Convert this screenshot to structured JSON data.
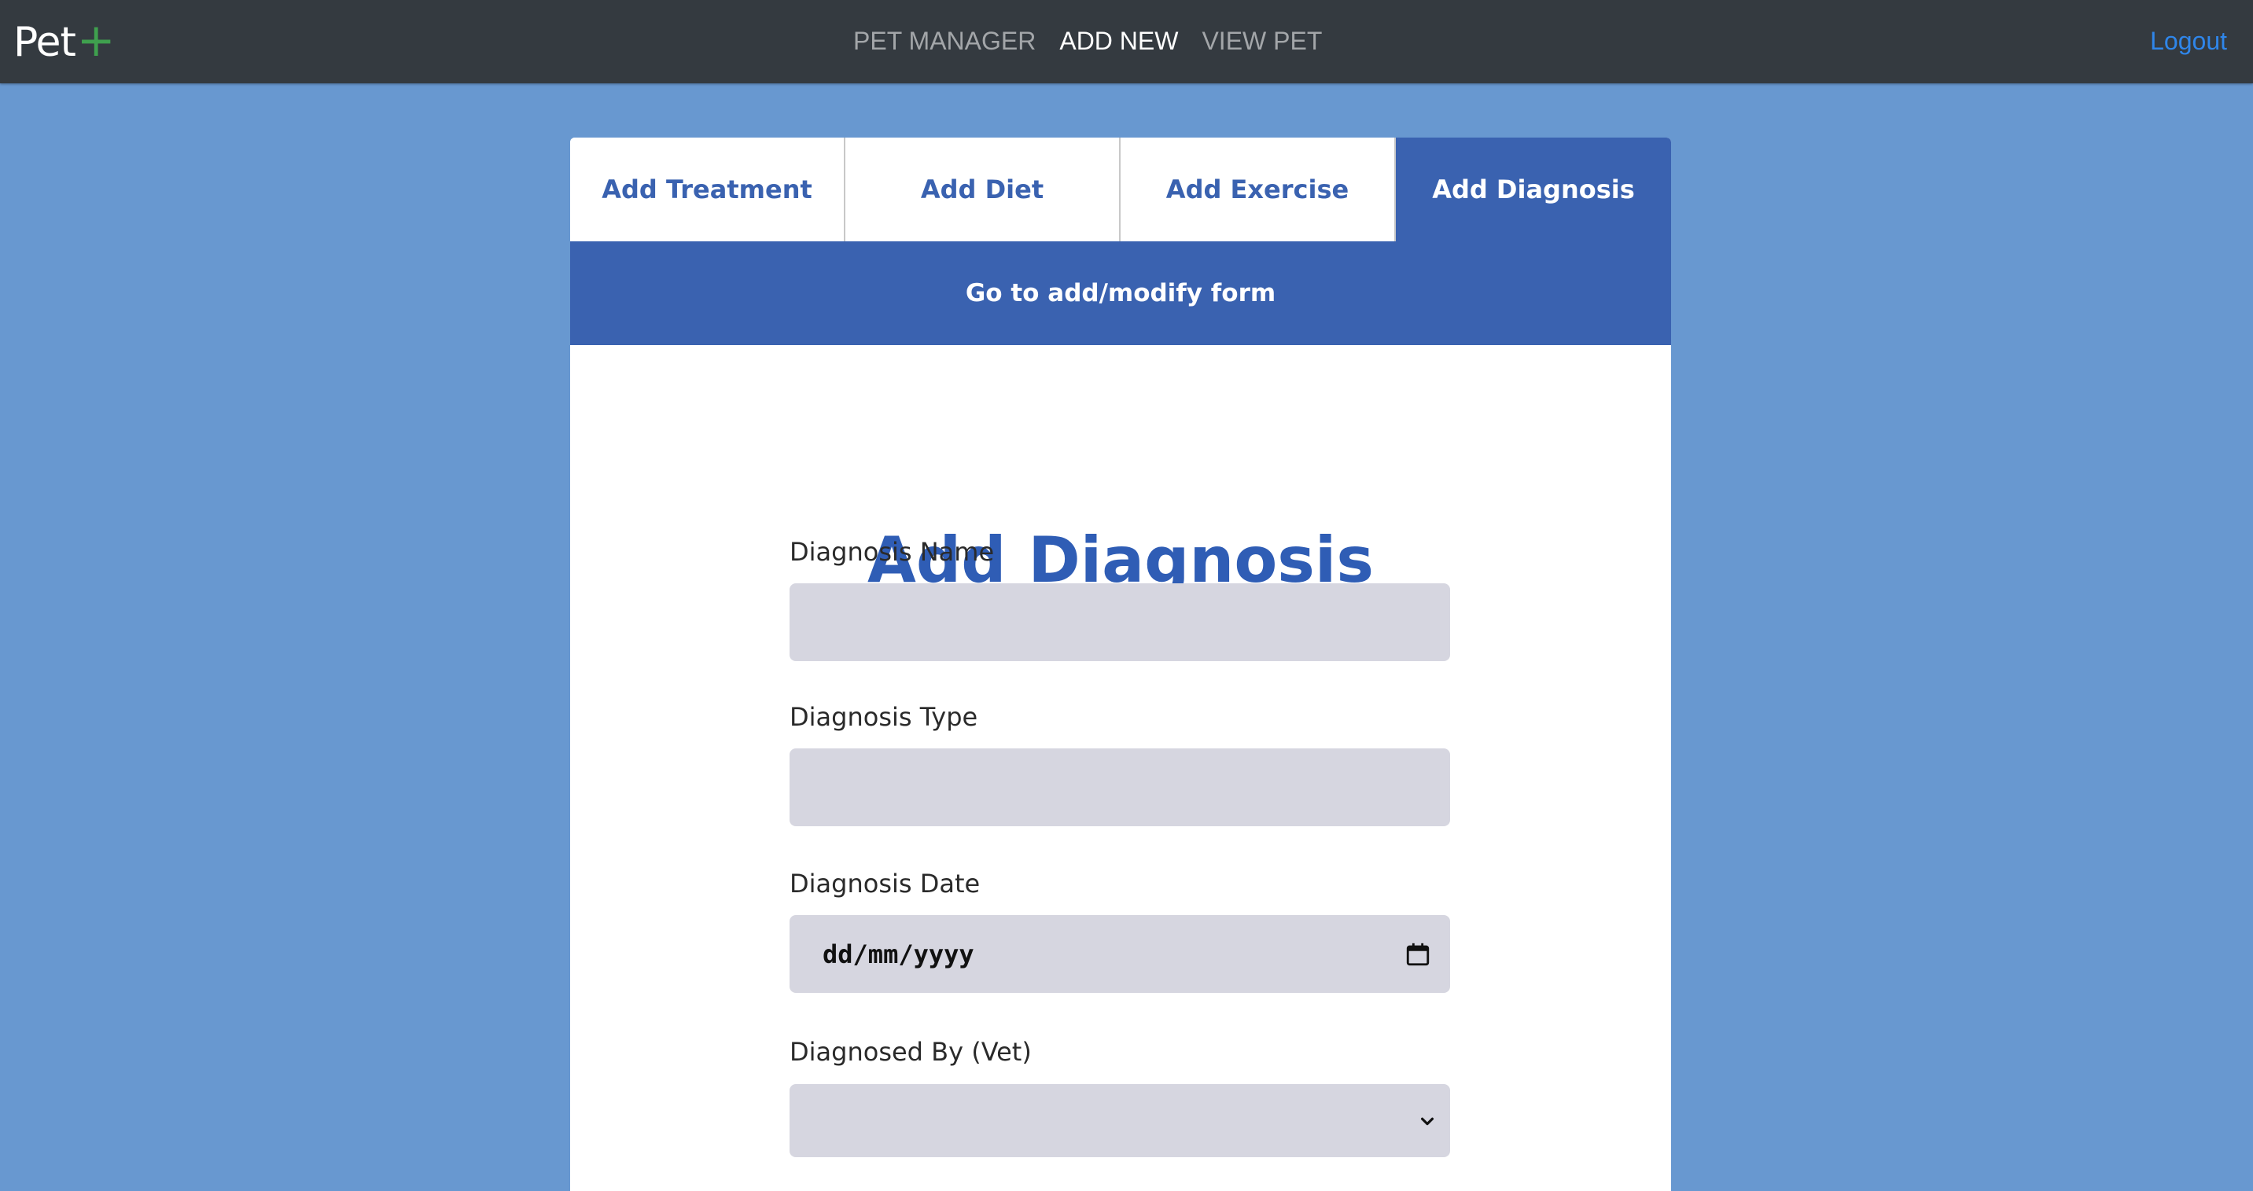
{
  "navbar": {
    "brand": "Pet",
    "brand_plus": "+",
    "links": [
      {
        "label": "PET MANAGER"
      },
      {
        "label": "ADD NEW"
      },
      {
        "label": "VIEW PET"
      }
    ],
    "logout": "Logout"
  },
  "tabs": [
    {
      "label": "Add Treatment"
    },
    {
      "label": "Add Diet"
    },
    {
      "label": "Add Exercise"
    },
    {
      "label": "Add Diagnosis"
    }
  ],
  "subbar": {
    "link": "Go to add/modify form"
  },
  "form": {
    "title": "Add Diagnosis",
    "fields": {
      "diagnosis_name": {
        "label": "Diagnosis Name",
        "value": ""
      },
      "diagnosis_type": {
        "label": "Diagnosis Type",
        "value": ""
      },
      "diagnosis_date": {
        "label": "Diagnosis Date",
        "placeholder": "dd/mm/yyyy"
      },
      "diagnosed_by": {
        "label": "Diagnosed By (Vet)",
        "value": ""
      }
    }
  },
  "icons": {
    "calendar": "calendar-icon",
    "select_arrow": "chevron-down-icon"
  },
  "colors": {
    "navbar": "#343a40",
    "page_background": "#6898d0",
    "accent_blue": "#3a62b0",
    "title_blue": "#2f5db5",
    "brand_plus": "#3fa04e",
    "logout": "#2f86ea",
    "input_background": "#d6d6e0"
  }
}
